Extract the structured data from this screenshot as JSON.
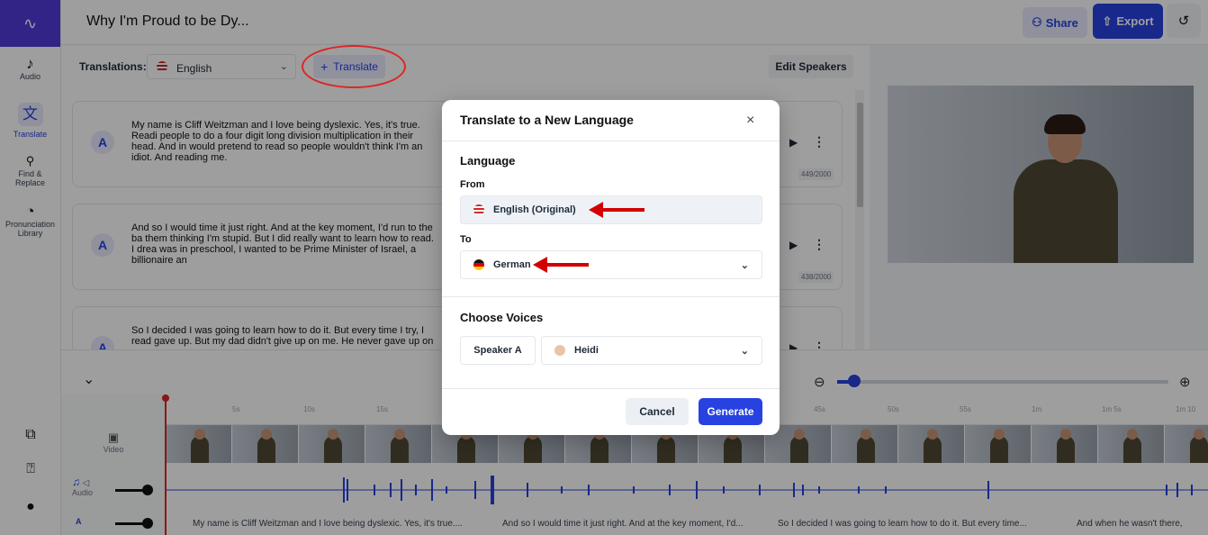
{
  "project": {
    "title": "Why I'm Proud to be Dy..."
  },
  "header": {
    "share_label": "Share",
    "export_label": "Export"
  },
  "sidebar": {
    "items": [
      {
        "label": "Audio"
      },
      {
        "label": "Translate"
      },
      {
        "label": "Find & Replace"
      },
      {
        "label": "Pronunciation Library"
      }
    ]
  },
  "translations": {
    "label": "Translations:",
    "selected_language": "English",
    "translate_button": "Translate",
    "edit_speakers_button": "Edit Speakers"
  },
  "transcript": {
    "cards": [
      {
        "speaker": "A",
        "text": "My name is Cliff Weitzman and I love being dyslexic. Yes, it's true. Readi people to do a four digit long division multiplication in their head. And in would pretend to read so people wouldn't think I'm an idiot. And reading me.",
        "count": "449/2000"
      },
      {
        "speaker": "A",
        "text": "And so I would time it just right. And at the key moment, I'd run to the ba them thinking I'm stupid. But I did really want to learn how to read. I drea was in preschool, I wanted to be Prime Minister of Israel, a billionaire an",
        "count": "438/2000"
      },
      {
        "speaker": "A",
        "text": "So I decided I was going to learn how to do it. But every time I try, I read gave up. But my dad didn't give up on me. He never gave up on me, eve",
        "count": ""
      }
    ]
  },
  "timeline": {
    "ruler": [
      "5s",
      "10s",
      "15s",
      "45s",
      "50s",
      "55s",
      "1m",
      "1m 5s",
      "1m 10"
    ],
    "video_label": "Video",
    "audio_label": "Audio",
    "text_clips": [
      "My name is Cliff Weitzman and I love being dyslexic. Yes, it's true....",
      "And so I would time it just right. And at the key moment, I'd...",
      "So I decided I was going to learn how to do it. But every time...",
      "And when he wasn't there,"
    ]
  },
  "modal": {
    "title": "Translate to a New Language",
    "language_section": "Language",
    "from_label": "From",
    "from_value": "English (Original)",
    "to_label": "To",
    "to_value": "German",
    "voices_section": "Choose Voices",
    "speaker_label": "Speaker A",
    "voice_value": "Heidi",
    "cancel_label": "Cancel",
    "generate_label": "Generate"
  },
  "colors": {
    "accent": "#2742e0",
    "brand": "#4f3ad9",
    "annotation": "#d40000"
  }
}
